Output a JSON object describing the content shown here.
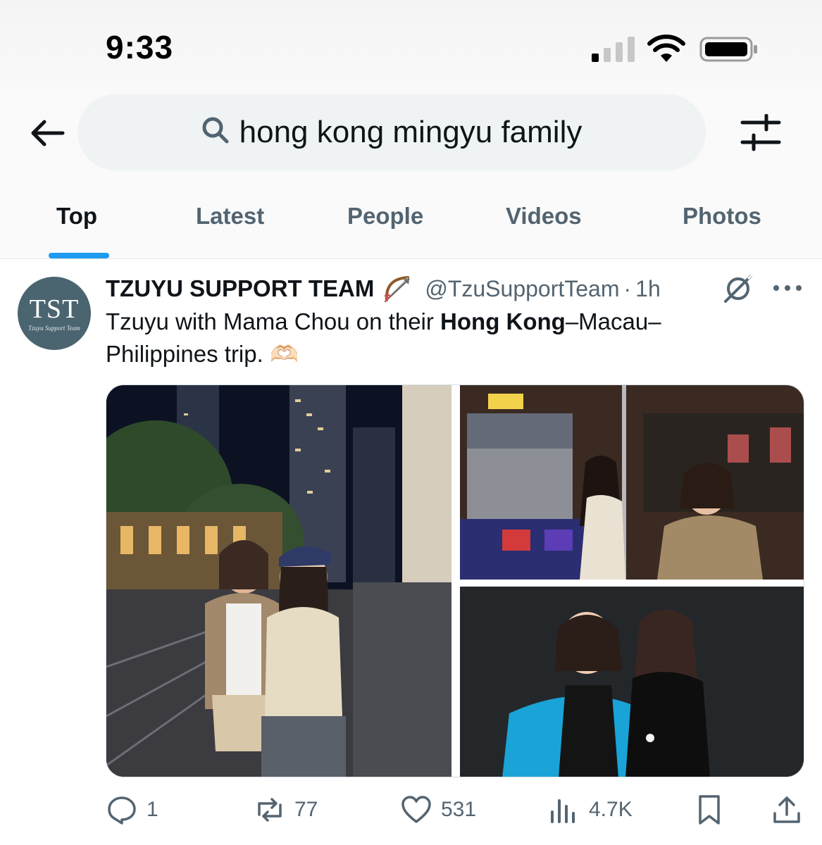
{
  "status_bar": {
    "time": "9:33"
  },
  "search": {
    "query": "hong kong mingyu family"
  },
  "tabs": [
    {
      "label": "Top"
    },
    {
      "label": "Latest"
    },
    {
      "label": "People"
    },
    {
      "label": "Videos"
    },
    {
      "label": "Photos"
    }
  ],
  "tweet": {
    "avatar_text": "TST",
    "avatar_subtext": "Tzuyu Support Team",
    "display_name": "TZUYU SUPPORT TEAM",
    "name_emoji": "bow-and-arrow-icon",
    "handle": "@TzuSupportTeam",
    "separator": "·",
    "time_ago": "1h",
    "text_before": "Tzuyu with Mama Chou on their ",
    "text_bold": "Hong Kong",
    "text_after": "–Macau–Philippines trip. 🫶🏻",
    "photos": [
      {
        "name": "night street portrait"
      },
      {
        "name": "tram interior"
      },
      {
        "name": "studio portrait"
      }
    ],
    "stats": {
      "replies": "1",
      "reposts": "77",
      "likes": "531",
      "views": "4.7K"
    }
  },
  "colors": {
    "accent": "#1d9bf0",
    "text_primary": "#0f1419",
    "text_secondary": "#536471",
    "search_bg": "#eff3f4"
  }
}
